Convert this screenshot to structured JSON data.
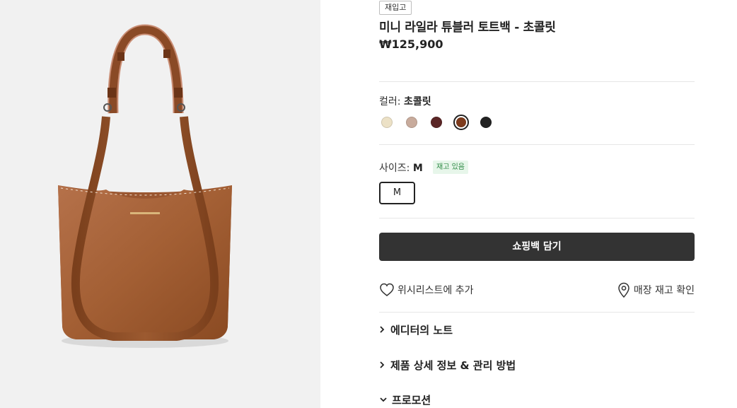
{
  "product": {
    "badge": "재입고",
    "title": "미니 라일라 튜블러 토트백 - 초콜릿",
    "price": "₩125,900"
  },
  "color": {
    "label": "컬러:",
    "selected": "초콜릿",
    "swatches": [
      {
        "hex": "#ece1c6"
      },
      {
        "hex": "#c8ab9c"
      },
      {
        "hex": "#5b2626"
      },
      {
        "hex": "#7e3b1c",
        "selected": true
      },
      {
        "hex": "#222222"
      }
    ]
  },
  "size": {
    "label": "사이즈:",
    "selected": "M",
    "stock_badge": "재고 있음",
    "options": [
      "M"
    ]
  },
  "cart_button": "쇼핑백 담기",
  "wishlist": "위시리스트에 추가",
  "store_check": "매장 재고 확인",
  "accordions": [
    {
      "label": "에디터의 노트",
      "expanded": false
    },
    {
      "label": "제품 상세 정보 & 관리 방법",
      "expanded": false
    },
    {
      "label": "프로모션",
      "expanded": true
    }
  ],
  "icons": {
    "wishlist": "heart-icon",
    "store": "location-pin-icon",
    "collapsed": "chevron-right-icon",
    "expanded": "chevron-down-icon"
  }
}
